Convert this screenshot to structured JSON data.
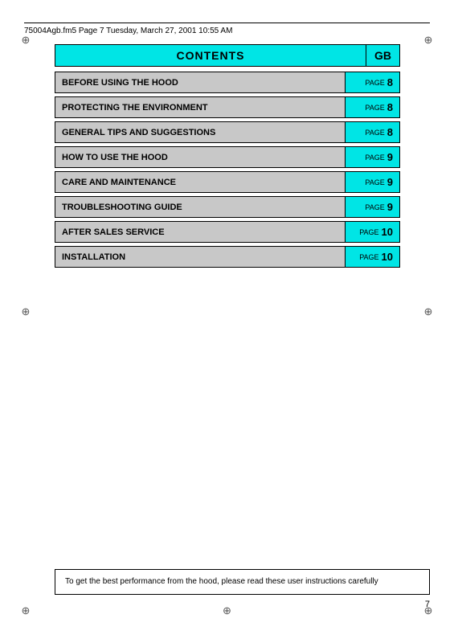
{
  "header": {
    "text": "75004Agb.fm5  Page 7  Tuesday, March 27, 2001  10:55 AM"
  },
  "contents": {
    "title": "CONTENTS",
    "gb_label": "GB"
  },
  "toc_items": [
    {
      "title": "BEFORE USING THE HOOD",
      "page_word": "PAGE",
      "page_num": "8"
    },
    {
      "title": "PROTECTING THE ENVIRONMENT",
      "page_word": "PAGE",
      "page_num": "8"
    },
    {
      "title": "GENERAL TIPS AND SUGGESTIONS",
      "page_word": "PAGE",
      "page_num": "8"
    },
    {
      "title": "HOW TO USE THE HOOD",
      "page_word": "PAGE",
      "page_num": "9"
    },
    {
      "title": "CARE AND MAINTENANCE",
      "page_word": "PAGE",
      "page_num": "9"
    },
    {
      "title": "TROUBLESHOOTING GUIDE",
      "page_word": "PAGE",
      "page_num": "9"
    },
    {
      "title": "AFTER SALES SERVICE",
      "page_word": "PAGE",
      "page_num": "10"
    },
    {
      "title": "INSTALLATION",
      "page_word": "PAGE",
      "page_num": "10"
    }
  ],
  "bottom_note": "To get the best performance from the hood, please read these user instructions carefully",
  "page_number": "7"
}
